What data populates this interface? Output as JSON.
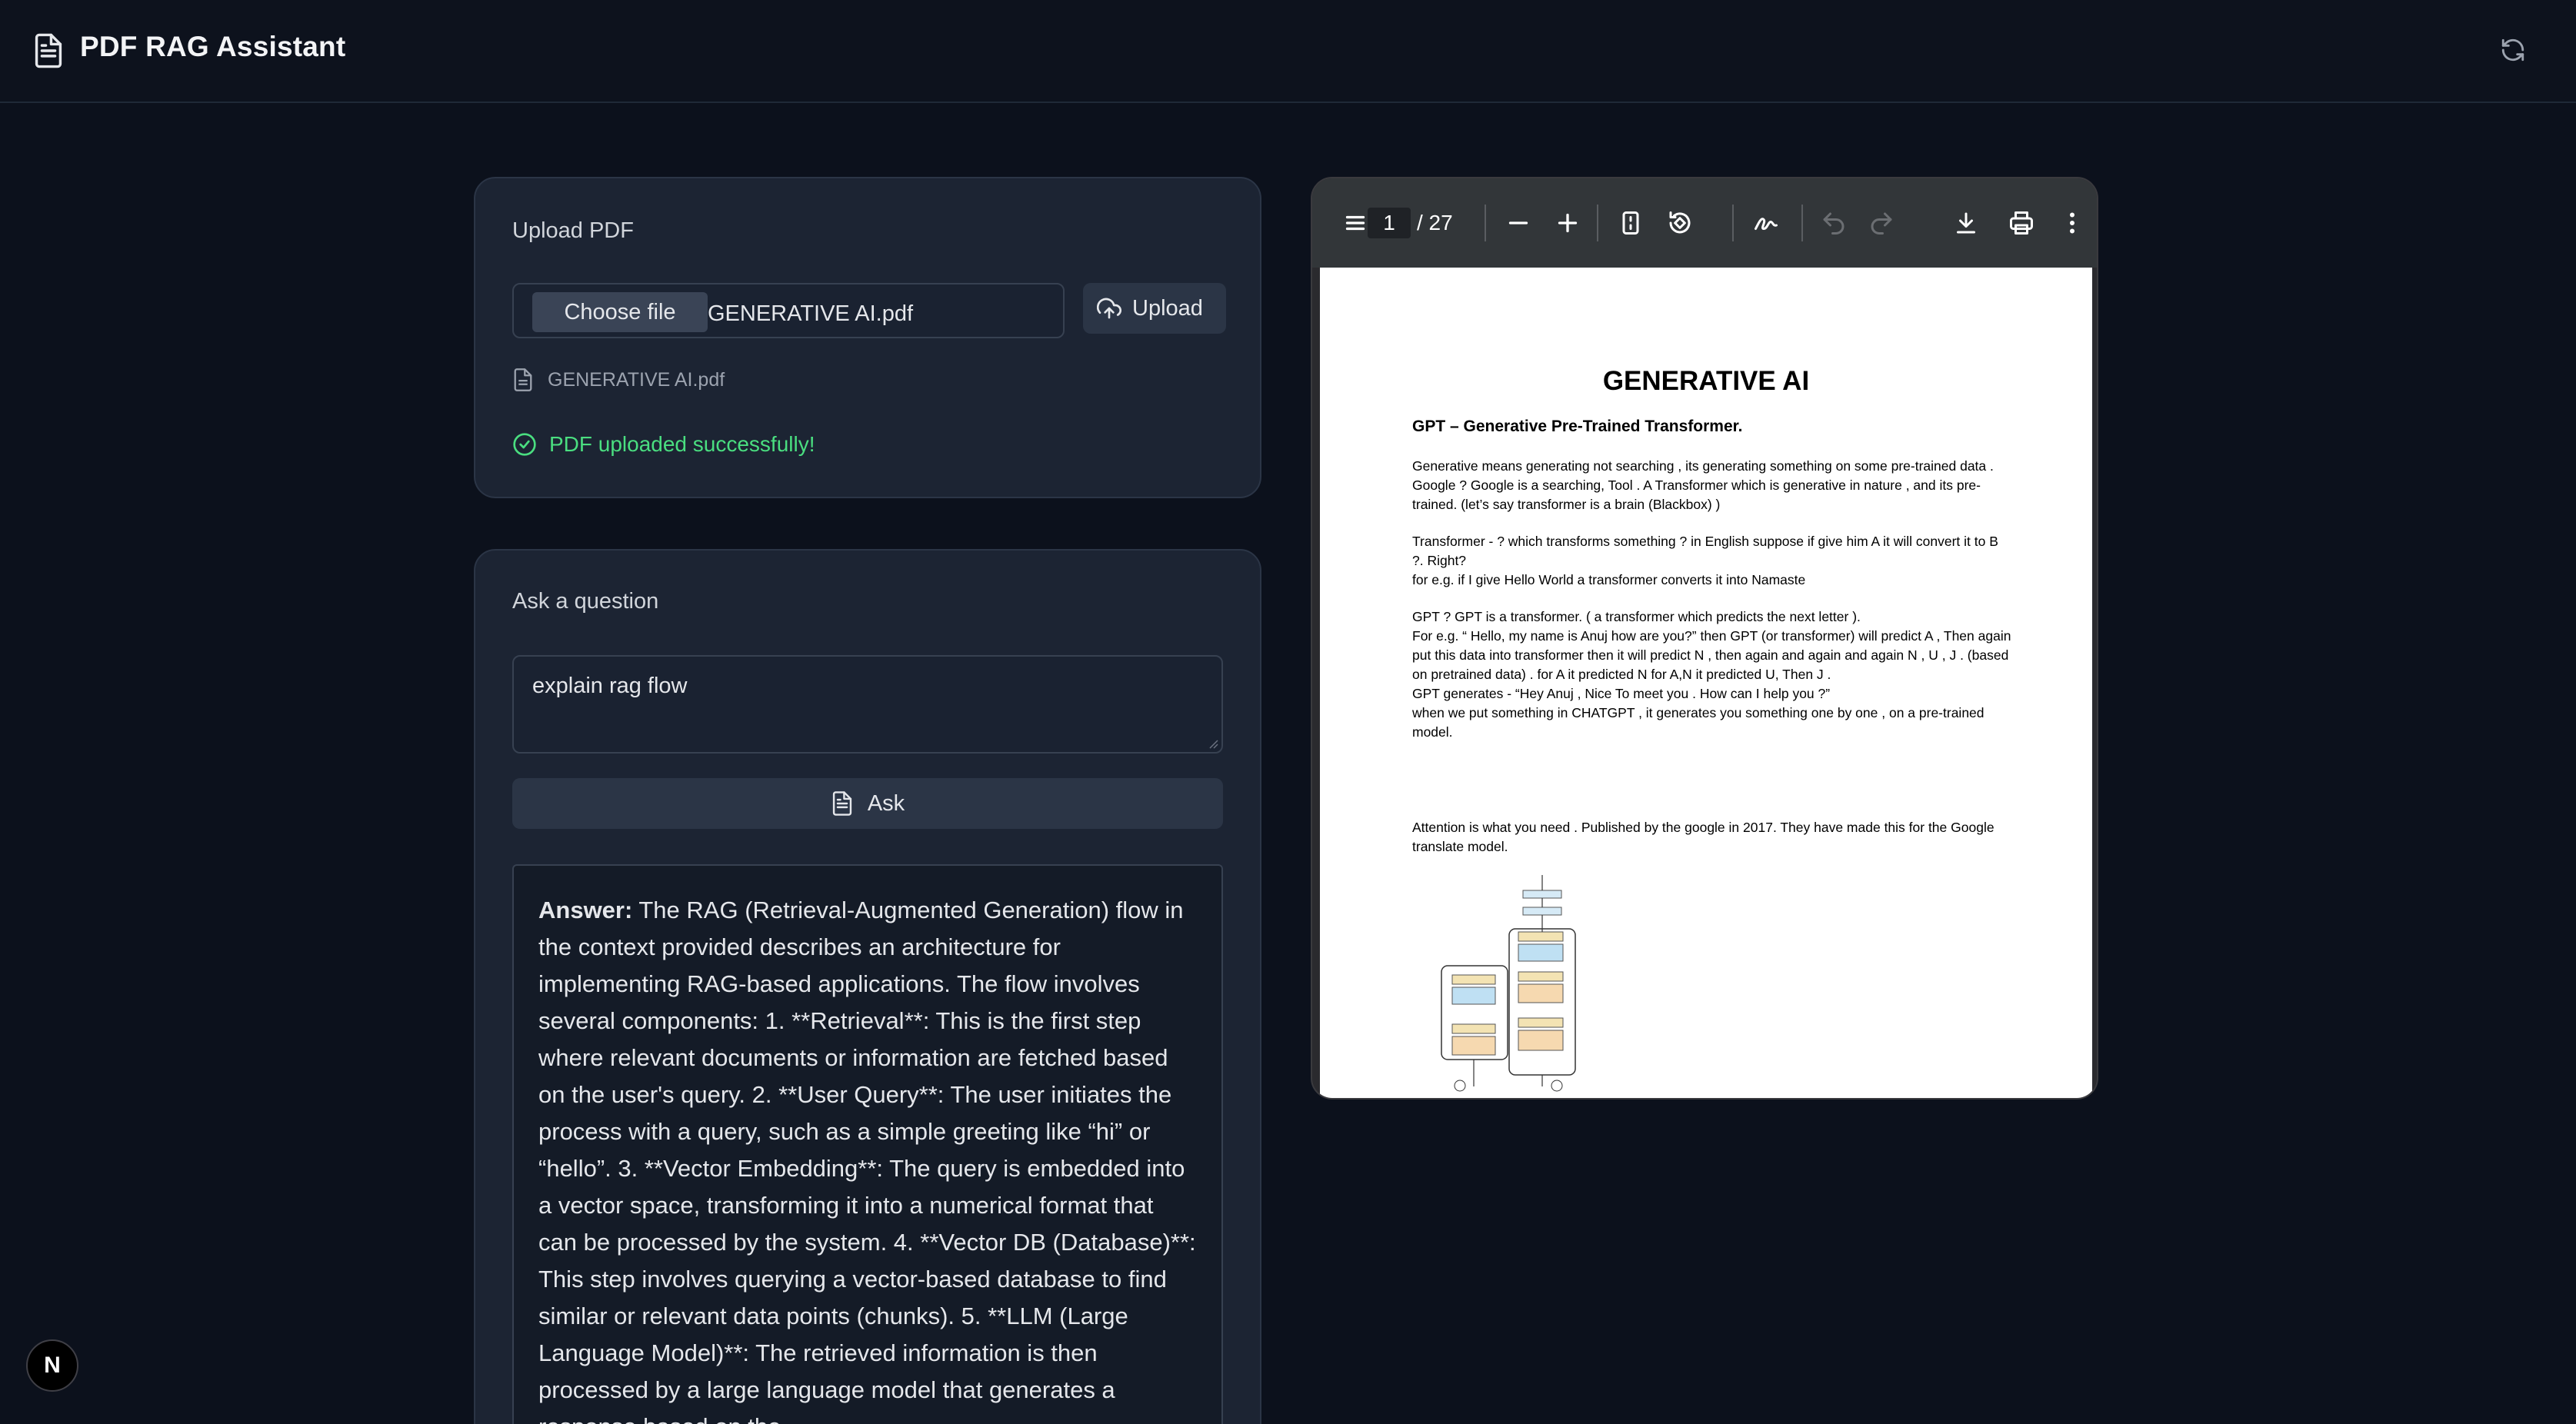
{
  "header": {
    "title": "PDF RAG Assistant",
    "logo_icon": "file-text-icon",
    "refresh_icon": "refresh-icon"
  },
  "upload": {
    "title": "Upload PDF",
    "choose_label": "Choose file",
    "file_name": "GENERATIVE AI.pdf",
    "upload_label": "Upload",
    "selected_file": "GENERATIVE AI.pdf",
    "status": "PDF uploaded successfully!",
    "status_color": "#4ade80"
  },
  "ask": {
    "title": "Ask a question",
    "question": "explain rag flow",
    "ask_label": "Ask",
    "answer_label": "Answer:",
    "answer_text": "The RAG (Retrieval-Augmented Generation) flow in the context provided describes an architecture for implementing RAG-based applications. The flow involves several components: 1. **Retrieval**: This is the first step where relevant documents or information are fetched based on the user's query. 2. **User Query**: The user initiates the process with a query, such as a simple greeting like “hi” or “hello”. 3. **Vector Embedding**: The query is embedded into a vector space, transforming it into a numerical format that can be processed by the system. 4. **Vector DB (Database)**: This step involves querying a vector-based database to find similar or relevant data points (chunks). 5. **LLM (Large Language Model)**: The retrieved information is then processed by a large language model that generates a response based on the"
  },
  "pdf_viewer": {
    "current_page": "1",
    "total_pages": "/ 27",
    "doc": {
      "title": "GENERATIVE AI",
      "subtitle": "GPT – Generative Pre-Trained Transformer.",
      "para1": "Generative means generating not searching , its generating something on some pre-trained data . Google ? Google is a searching, Tool . A Transformer which is generative in nature , and its pre-trained. (let’s say transformer is a brain (Blackbox) )",
      "para2": "Transformer - ? which transforms something ? in English suppose if give him A it will convert it to B ?. Right?\nfor e.g. if I give Hello World a transformer converts it into Namaste",
      "para3": "GPT ? GPT is a transformer. ( a transformer which predicts the next letter ).\nFor e.g. “ Hello, my name is Anuj how are you?”  then GPT (or transformer) will predict A , Then again put this data into transformer then it will predict N , then again and again and again N , U , J . (based on pretrained data) . for A it predicted N for A,N it predicted U, Then J .\nGPT generates - “Hey Anuj , Nice To meet you . How can I help you ?”\nwhen we put something in CHATGPT , it generates you something one by one , on a pre-trained model.",
      "para4": "Attention is what you need . Published by the google in 2017. They have made this for the Google translate model."
    }
  },
  "badge": {
    "label": "N"
  }
}
